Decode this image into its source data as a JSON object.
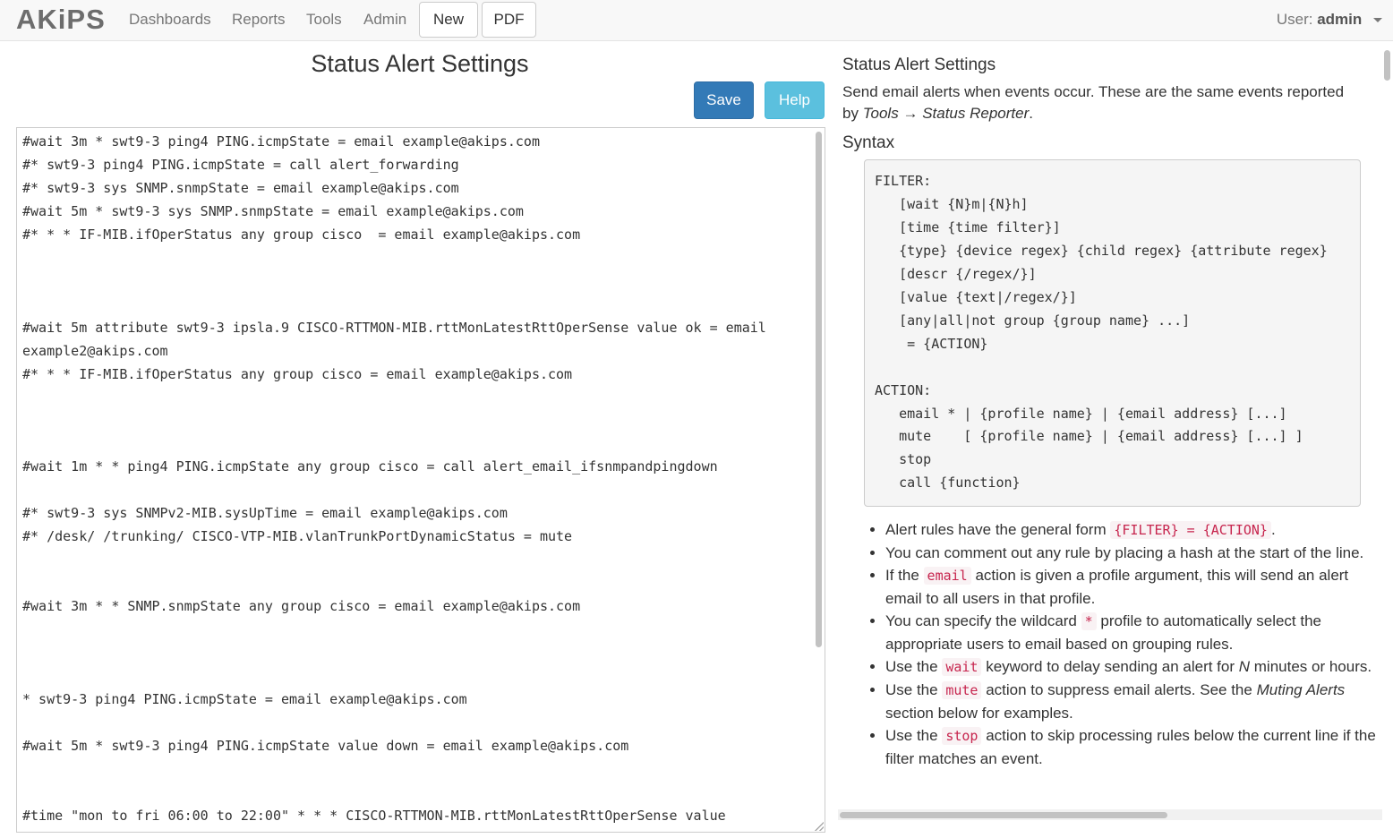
{
  "app": {
    "logo": "AKiPS"
  },
  "nav": {
    "links": [
      "Dashboards",
      "Reports",
      "Tools",
      "Admin"
    ],
    "buttons": [
      "New",
      "PDF"
    ],
    "user_label": "User:",
    "user_name": "admin"
  },
  "page": {
    "title": "Status Alert Settings",
    "save_label": "Save",
    "help_label": "Help"
  },
  "editor": {
    "lines": [
      "#wait 3m * swt9-3 ping4 PING.icmpState = email example@akips.com",
      "#* swt9-3 ping4 PING.icmpState = call alert_forwarding",
      "#* swt9-3 sys SNMP.snmpState = email example@akips.com",
      "#wait 5m * swt9-3 sys SNMP.snmpState = email example@akips.com",
      "#* * * IF-MIB.ifOperStatus any group cisco  = email example@akips.com",
      "",
      "",
      "",
      "#wait 5m attribute swt9-3 ipsla.9 CISCO-RTTMON-MIB.rttMonLatestRttOperSense value ok = email",
      "example2@akips.com",
      "#* * * IF-MIB.ifOperStatus any group cisco = email example@akips.com",
      "",
      "",
      "",
      "#wait 1m * * ping4 PING.icmpState any group cisco = call alert_email_ifsnmpandpingdown",
      "",
      "#* swt9-3 sys SNMPv2-MIB.sysUpTime = email example@akips.com",
      "#* /desk/ /trunking/ CISCO-VTP-MIB.vlanTrunkPortDynamicStatus = mute",
      "",
      "",
      "#wait 3m * * SNMP.snmpState any group cisco = email example@akips.com",
      "",
      "",
      "",
      "* swt9-3 ping4 PING.icmpState = email example@akips.com",
      "",
      "#wait 5m * swt9-3 ping4 PING.icmpState value down = email example@akips.com",
      "",
      "",
      "#time \"mon to fri 06:00 to 22:00\" * * * CISCO-RTTMON-MIB.rttMonLatestRttOperSense value"
    ]
  },
  "help": {
    "title": "Status Alert Settings",
    "intro_text": "Send email alerts when events occur. These are the same events reported by",
    "intro_menu_1": "Tools",
    "intro_arrow": "→",
    "intro_menu_2": "Status Reporter",
    "intro_end": ".",
    "syntax_heading": "Syntax",
    "syntax_lines": [
      "FILTER:",
      "   [wait {N}m|{N}h]",
      "   [time {time filter}]",
      "   {type} {device regex} {child regex} {attribute regex}",
      "   [descr {/regex/}]",
      "   [value {text|/regex/}]",
      "   [any|all|not group {group name} ...]",
      "    = {ACTION}",
      "",
      "ACTION:",
      "   email * | {profile name} | {email address} [...]",
      "   mute    [ {profile name} | {email address} [...] ]",
      "   stop",
      "   call {function}"
    ],
    "bullets": {
      "b1_pre": "Alert rules have the general form",
      "b1_code": "{FILTER} = {ACTION}",
      "b1_post": ".",
      "b2": "You can comment out any rule by placing a hash at the start of the line.",
      "b3_pre": "If the",
      "b3_code": "email",
      "b3_post": "action is given a profile argument, this will send an alert email to all users in that profile.",
      "b4_pre": "You can specify the wildcard",
      "b4_code": "*",
      "b4_post": "profile to automatically select the appropriate users to email based on grouping rules.",
      "b5_pre": "Use the",
      "b5_code": "wait",
      "b5_mid": "keyword to delay sending an alert for",
      "b5_n": "N",
      "b5_post": "minutes or hours.",
      "b6_pre": "Use the",
      "b6_code": "mute",
      "b6_mid": "action to suppress email alerts. See the",
      "b6_em": "Muting Alerts",
      "b6_post": "section below for examples.",
      "b7_pre": "Use the",
      "b7_code": "stop",
      "b7_post": "action to skip processing rules below the current line if the filter matches an event."
    }
  },
  "colors": {
    "primary": "#337ab7",
    "info": "#5bc0de",
    "code_text": "#c7254e"
  }
}
